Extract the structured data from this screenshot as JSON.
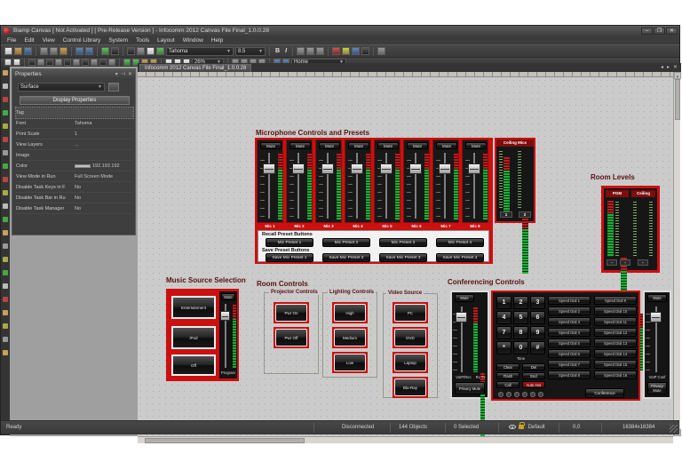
{
  "window": {
    "title": "Biamp Canvas  [ Not Activated ]  [ Pre-Release Version ] - Infocomm 2012 Canvas File Final_1.0.0.28",
    "controls": {
      "minimize": "–",
      "maximize": "❐",
      "close": "✕"
    }
  },
  "menus": [
    "File",
    "Edit",
    "View",
    "Control Library",
    "System",
    "Tools",
    "Layout",
    "Window",
    "Help"
  ],
  "toolbar": {
    "font": "Tahoma",
    "font_size": "8.5",
    "bold": "B",
    "italic": "I",
    "zoom": "26%",
    "home": "Home"
  },
  "tab": {
    "label": "Infocomm 2012 Canvas File Final_1.0.0.28",
    "prev": "◂",
    "next": "▸",
    "close": "✕"
  },
  "properties_panel": {
    "title": "Properties",
    "selector": "Surface",
    "section": "Display Properties",
    "rows": [
      {
        "label": "Tag",
        "value": ""
      },
      {
        "label": "Font",
        "value": "Tahoma"
      },
      {
        "label": "Print Scale",
        "value": "1"
      },
      {
        "label": "View Layers",
        "value": "..."
      },
      {
        "label": "Image",
        "value": ""
      },
      {
        "label": "Color",
        "value": "192.192.192"
      },
      {
        "label": "View Mode in Run",
        "value": "Full Screen Mode"
      },
      {
        "label": "Disable Task Keys in F",
        "value": "No"
      },
      {
        "label": "Disable Task Bar in Ru",
        "value": "No"
      },
      {
        "label": "Disable Task Manager",
        "value": "No"
      }
    ]
  },
  "colors": {
    "accent_red": "#cc0f0f",
    "meter_green": "#1fae3a",
    "panel_dark": "#161616"
  },
  "mic_section": {
    "heading": "Microphone Controls and Presets",
    "channels": [
      {
        "mute": "Mute",
        "label": "Mic 1"
      },
      {
        "mute": "Mute",
        "label": "Mic 2"
      },
      {
        "mute": "Mute",
        "label": "Mic 3"
      },
      {
        "mute": "Mute",
        "label": "Mic 4"
      },
      {
        "mute": "Mute",
        "label": "Mic 5"
      },
      {
        "mute": "Mute",
        "label": "Mic 6"
      },
      {
        "mute": "Mute",
        "label": "Mic 7"
      },
      {
        "mute": "Mute",
        "label": "Mic 8"
      }
    ],
    "recall_label": "Recall Preset Buttons",
    "recall_buttons": [
      "Mic Preset 1",
      "Mic Preset 2",
      "Mic Preset 3",
      "Mic Preset 4"
    ],
    "save_label": "Save Preset Buttons",
    "save_buttons": [
      "Save Mic Preset 1",
      "Save Mic Preset 2",
      "Save Mic Preset 3",
      "Save Mic Preset 4"
    ]
  },
  "ceiling_mics": {
    "title": "Ceiling Mics",
    "meter_labels": [
      "1",
      "2"
    ]
  },
  "room_levels": {
    "heading": "Room Levels",
    "group_labels": [
      "PGM",
      "Ceiling"
    ],
    "meter_labels": [
      "-",
      "-",
      "-"
    ]
  },
  "music_section": {
    "heading": "Music Source Selection",
    "buttons": [
      "Entertainment",
      "iPod",
      "Off"
    ],
    "mute": "Mute",
    "fader_label": "Program"
  },
  "room_controls": {
    "heading": "Room Controls",
    "projector": {
      "title": "Projector Controls",
      "buttons": [
        "Pwr On",
        "Pwr Off"
      ]
    },
    "lighting": {
      "title": "Lighting Controls",
      "buttons": [
        "High",
        "Medium",
        "Low"
      ]
    }
  },
  "video_source": {
    "title": "Video Source",
    "buttons": [
      "PC",
      "DVD",
      "Laptop",
      "Blu-Ray"
    ]
  },
  "conferencing": {
    "heading": "Conferencing Controls",
    "left_fader": {
      "mute": "Mute",
      "meter_labels": "Rx  Tx",
      "label": "VoIP/Rec",
      "button": "Privacy Mute"
    },
    "keypad": [
      "1",
      "2",
      "3",
      "4",
      "5",
      "6",
      "7",
      "8",
      "9",
      "*",
      "0",
      "#"
    ],
    "tone": "Tone",
    "call_buttons": [
      {
        "left": "Clear",
        "right": "Del"
      },
      {
        "left": "Flash",
        "right": "End"
      },
      {
        "left": "Call",
        "right": "Auto Ans"
      }
    ],
    "conference_button": "Conference",
    "speed_dials_left": [
      "Speed Dial 1",
      "Speed Dial 2",
      "Speed Dial 3",
      "Speed Dial 4",
      "Speed Dial 5",
      "Speed Dial 6",
      "Speed Dial 7",
      "Speed Dial 8"
    ],
    "speed_dials_right": [
      "Speed Dial 9",
      "Speed Dial 10",
      "Speed Dial 11",
      "Speed Dial 12",
      "Speed Dial 13",
      "Speed Dial 14",
      "Speed Dial 15",
      "Speed Dial 16"
    ],
    "right_fader": {
      "mute": "Mute",
      "label": "VoIP Conf",
      "button": "Privacy Mute"
    }
  },
  "status_bar": {
    "ready": "Ready",
    "connection": "Disconnected",
    "objects": "144 Objects",
    "selected": "0 Selected",
    "layer": "Default",
    "coords": "0,0",
    "canvas_size": "16384x16384"
  }
}
